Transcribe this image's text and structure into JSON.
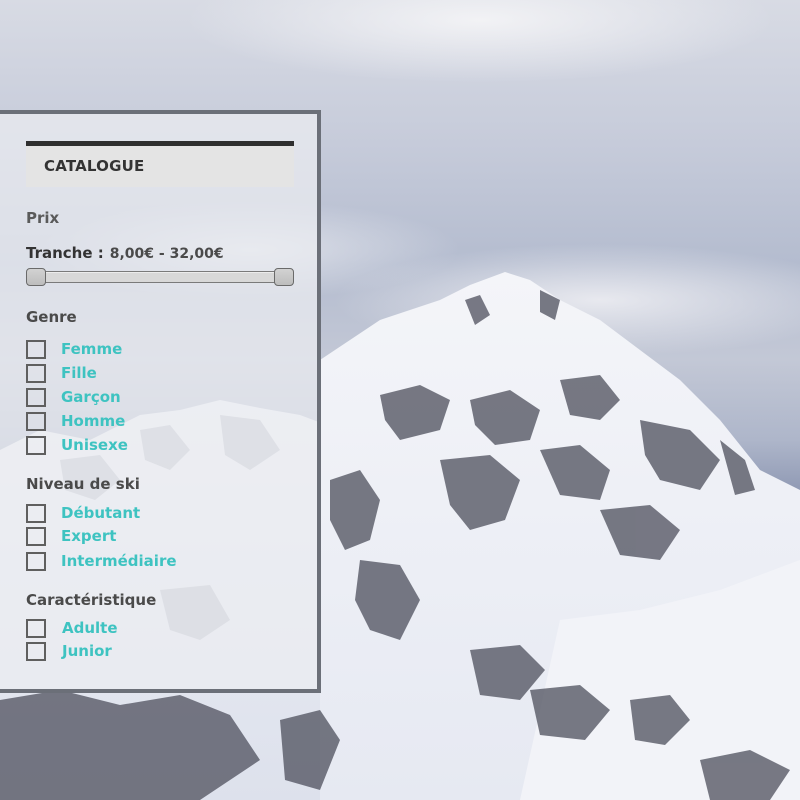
{
  "colors": {
    "accent": "#3ec3c1",
    "panel_border": "#6b6f78",
    "header_bar": "#2f2f2f",
    "header_bg": "#e4e4e4",
    "text_dark": "#333333"
  },
  "catalogue": {
    "title": "CATALOGUE"
  },
  "price": {
    "section_title": "Prix",
    "range_label": "Tranche :",
    "range_value": "8,00€ - 32,00€",
    "min": 8.0,
    "max": 32.0,
    "selected_min": 8.0,
    "selected_max": 32.0,
    "currency": "€"
  },
  "genre": {
    "section_title": "Genre",
    "options": [
      {
        "label": "Femme",
        "checked": false
      },
      {
        "label": "Fille",
        "checked": false
      },
      {
        "label": "Garçon",
        "checked": false
      },
      {
        "label": "Homme",
        "checked": false
      },
      {
        "label": "Unisexe",
        "checked": false
      }
    ]
  },
  "ski_level": {
    "section_title": "Niveau de ski",
    "options": [
      {
        "label": "Débutant",
        "checked": false
      },
      {
        "label": "Expert",
        "checked": false
      },
      {
        "label": "Intermédiaire",
        "checked": false
      }
    ]
  },
  "characteristic": {
    "section_title": "Caractéristique",
    "options": [
      {
        "label": "Adulte",
        "checked": false
      },
      {
        "label": "Junior",
        "checked": false
      }
    ]
  },
  "background": {
    "icon": "snowy-mountain-photo"
  }
}
